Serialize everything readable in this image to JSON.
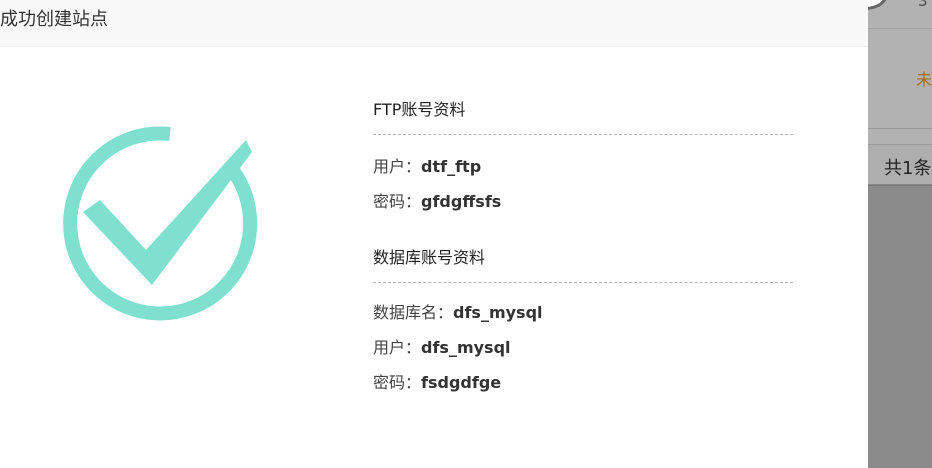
{
  "background": {
    "top_text": "3",
    "status_text": "未",
    "pager_label": "共1条"
  },
  "dialog": {
    "title": "成功创建站点",
    "icon": "success-check-icon",
    "accent_color": "#7fe0d0",
    "ftp": {
      "heading": "FTP账号资料",
      "user_label": "用户：",
      "user_value": "dtf_ftp",
      "password_label": "密码：",
      "password_value": "gfdgffsfs"
    },
    "database": {
      "heading": "数据库账号资料",
      "dbname_label": "数据库名：",
      "dbname_value": "dfs_mysql",
      "user_label": "用户：",
      "user_value": "dfs_mysql",
      "password_label": "密码：",
      "password_value": "fsdgdfge"
    }
  }
}
